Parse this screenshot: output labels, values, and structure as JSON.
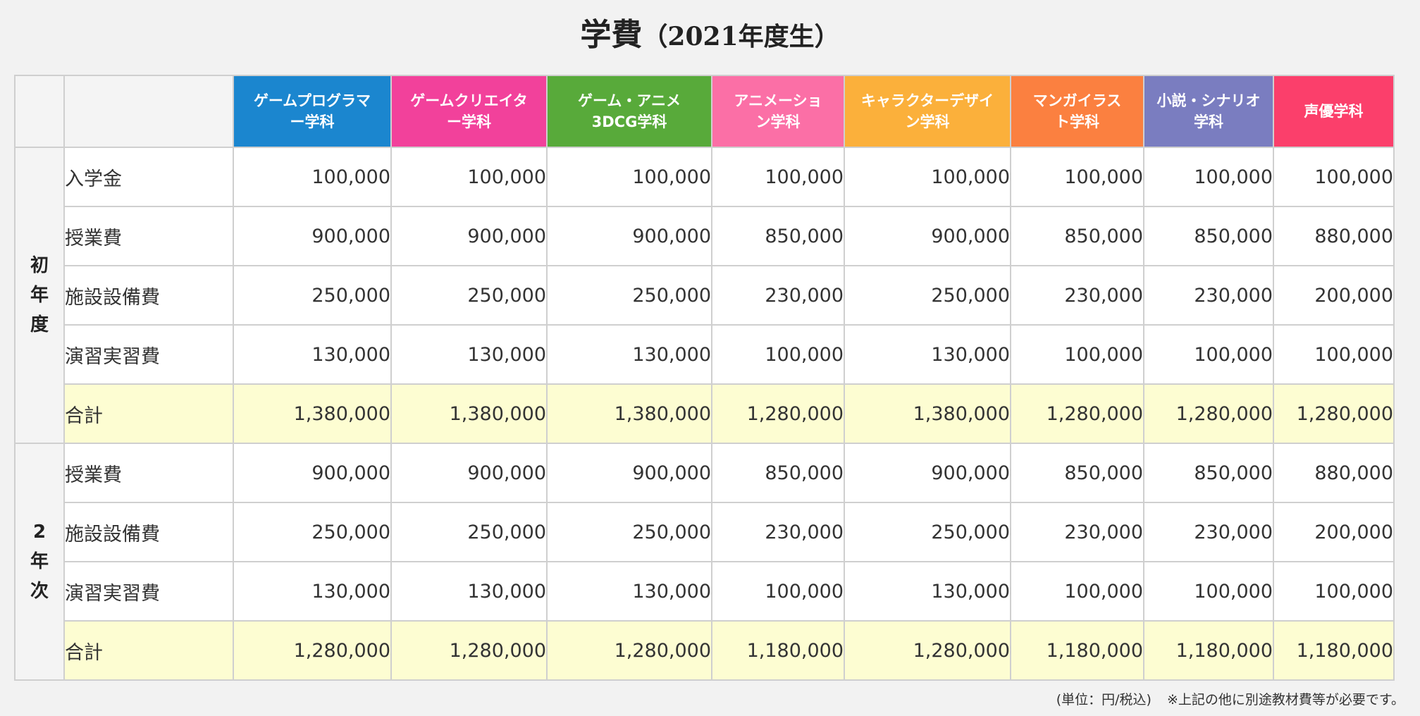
{
  "title": {
    "main": "学費",
    "sub": "（2021年度生）"
  },
  "colors": {
    "header_bg": "#f4f4f4",
    "total_bg": "#fdfdd2",
    "border": "#cfcfcf"
  },
  "departments": [
    {
      "label": "ゲームプログラマー学科",
      "color": "#1b86cf"
    },
    {
      "label": "ゲームクリエイター学科",
      "color": "#f2419b"
    },
    {
      "label": "ゲーム・アニメ3DCG学科",
      "color": "#58aa3a"
    },
    {
      "label": "アニメーション学科",
      "color": "#fb6fa6"
    },
    {
      "label": "キャラクターデザイン学科",
      "color": "#fbb03b"
    },
    {
      "label": "マンガイラスト学科",
      "color": "#fb8040"
    },
    {
      "label": "小説・シナリオ学科",
      "color": "#7a7dc0"
    },
    {
      "label": "声優学科",
      "color": "#fb3f6b"
    }
  ],
  "header_lines": [
    "ゲームプログラマ\nー学科",
    "ゲームクリエイタ\nー学科",
    "ゲーム・アニメ\n3DCG学科",
    "アニメーショ\nン学科",
    "キャラクターデザイ\nン学科",
    "マンガイラス\nト学科",
    "小説・シナリオ\n学科",
    "声優学科"
  ],
  "sections": [
    {
      "year_label": "初年度",
      "rows": [
        {
          "item": "入学金",
          "total": false,
          "values": [
            "100,000",
            "100,000",
            "100,000",
            "100,000",
            "100,000",
            "100,000",
            "100,000",
            "100,000"
          ]
        },
        {
          "item": "授業費",
          "total": false,
          "values": [
            "900,000",
            "900,000",
            "900,000",
            "850,000",
            "900,000",
            "850,000",
            "850,000",
            "880,000"
          ]
        },
        {
          "item": "施設設備費",
          "total": false,
          "values": [
            "250,000",
            "250,000",
            "250,000",
            "230,000",
            "250,000",
            "230,000",
            "230,000",
            "200,000"
          ]
        },
        {
          "item": "演習実習費",
          "total": false,
          "values": [
            "130,000",
            "130,000",
            "130,000",
            "100,000",
            "130,000",
            "100,000",
            "100,000",
            "100,000"
          ]
        },
        {
          "item": "合計",
          "total": true,
          "values": [
            "1,380,000",
            "1,380,000",
            "1,380,000",
            "1,280,000",
            "1,380,000",
            "1,280,000",
            "1,280,000",
            "1,280,000"
          ]
        }
      ]
    },
    {
      "year_label": "2年次",
      "rows": [
        {
          "item": "授業費",
          "total": false,
          "values": [
            "900,000",
            "900,000",
            "900,000",
            "850,000",
            "900,000",
            "850,000",
            "850,000",
            "880,000"
          ]
        },
        {
          "item": "施設設備費",
          "total": false,
          "values": [
            "250,000",
            "250,000",
            "250,000",
            "230,000",
            "250,000",
            "230,000",
            "230,000",
            "200,000"
          ]
        },
        {
          "item": "演習実習費",
          "total": false,
          "values": [
            "130,000",
            "130,000",
            "130,000",
            "100,000",
            "130,000",
            "100,000",
            "100,000",
            "100,000"
          ]
        },
        {
          "item": "合計",
          "total": true,
          "values": [
            "1,280,000",
            "1,280,000",
            "1,280,000",
            "1,180,000",
            "1,280,000",
            "1,180,000",
            "1,180,000",
            "1,180,000"
          ]
        }
      ]
    }
  ],
  "footnote": {
    "unit": "(単位：円/税込)",
    "note": "※上記の他に別途教材費等が必要です。"
  }
}
